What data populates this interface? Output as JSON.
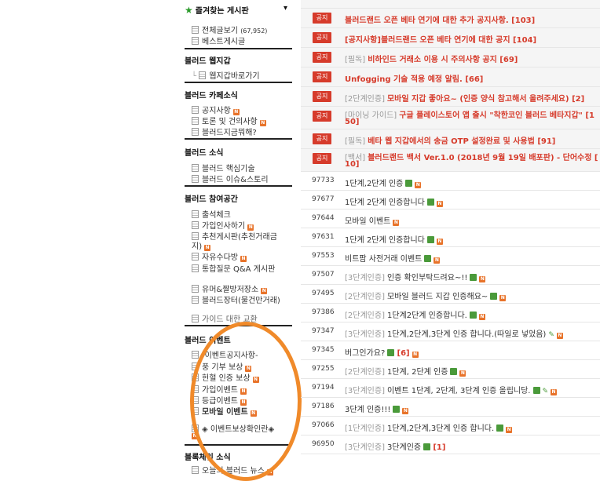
{
  "sidebar": {
    "favorites": {
      "title": "즐겨찾는 게시판",
      "toggle": "▾",
      "items": [
        {
          "label": "전체글보기",
          "count": "(67,952)"
        },
        {
          "label": "베스트게시글"
        }
      ]
    },
    "wallet": {
      "title": "블러드 웹지갑",
      "items": [
        {
          "label": "웹지갑바로가기"
        }
      ]
    },
    "cafe": {
      "title": "블러드 카페소식",
      "items": [
        {
          "label": "공지사항"
        },
        {
          "label": "토론 및 건의사항"
        },
        {
          "label": "블러드지금뭐해?"
        }
      ]
    },
    "news": {
      "title": "블러드 소식",
      "items": [
        {
          "label": "블러드 핵심기술"
        },
        {
          "label": "블러드 이슈&스토리"
        }
      ]
    },
    "participate": {
      "title": "블러드 참여공간",
      "items": [
        {
          "label": "출석체크"
        },
        {
          "label": "가입인사하기"
        },
        {
          "label": "추천게시판(추천거래금"
        },
        {
          "label": "지)"
        },
        {
          "label": "자유수다방"
        },
        {
          "label": "통합질문 Q&A 게시판"
        },
        {
          "label": "유머&짤방저장소"
        },
        {
          "label": "블러드장터(물건만거래)"
        },
        {
          "label": "가이드 대한 교환"
        }
      ]
    },
    "event": {
      "title": "블러드 이벤트",
      "items": [
        {
          "label": "-이벤트공지사항-"
        },
        {
          "label": "풍 기부 보상"
        },
        {
          "label": "헌혈 인증 보상"
        },
        {
          "label": "가입이벤트"
        },
        {
          "label": "등급이벤트"
        },
        {
          "label": "모바일 이벤트"
        },
        {
          "label": "◈ 이벤트보상확인란◈"
        }
      ]
    },
    "last": {
      "title": "블록체인 소식",
      "items": [
        {
          "label": "오늘의 블러드 뉴스"
        }
      ]
    }
  },
  "notices": [
    {
      "tag": "공지",
      "cat": "",
      "title": "블러드랜드 오픈 베타 연기에 대한 추가 공지사항.",
      "cnt": "[103]"
    },
    {
      "tag": "공지",
      "cat": "",
      "title": "[공지사항]블러드랜드 오픈 베타 연기에 대한 공지",
      "cnt": "[104]"
    },
    {
      "tag": "공지",
      "cat": "[필독]",
      "title": "비하인드 거래소 이용 시 주의사항 공지",
      "cnt": "[69]"
    },
    {
      "tag": "공지",
      "cat": "",
      "title": "Unfogging 기술 적용 예정 알림.",
      "cnt": "[66]"
    },
    {
      "tag": "공지",
      "cat": "[2단계인증]",
      "title": "모바일 지갑 좋아요~ (인증 양식 참고해서 올려주세요)",
      "cnt": "[2]"
    },
    {
      "tag": "공지",
      "cat": "[마이닝 가이드]",
      "title": "구글 플레이스토어 앱 출시 \"착한코인 블러드 베타지갑\" [1",
      "cnt": "50]"
    },
    {
      "tag": "공지",
      "cat": "[필독]",
      "title": "베타 웹 지갑에서의 송금 OTP 설정완료 및 사용법",
      "cnt": "[91]"
    },
    {
      "tag": "공지",
      "cat": "[백서]",
      "title": "블러드랜드 백서 Ver.1.0 (2018년 9월 19일 배포판) - 단어수정 [",
      "cnt": "10]"
    }
  ],
  "posts": [
    {
      "num": "97733",
      "cat": "",
      "title": "1단계,2단계 인증",
      "cnt": ""
    },
    {
      "num": "97677",
      "cat": "",
      "title": "1단계 2단계 인증합니다",
      "cnt": ""
    },
    {
      "num": "97644",
      "cat": "",
      "title": "모바일 이벤트",
      "cnt": ""
    },
    {
      "num": "97631",
      "cat": "",
      "title": "1단계 2단계 인증합니다",
      "cnt": ""
    },
    {
      "num": "97553",
      "cat": "",
      "title": "비트팜 사전거래 이벤트",
      "cnt": ""
    },
    {
      "num": "97507",
      "cat": "[3단계인증]",
      "title": "인증 확인부탁드려요~!!",
      "cnt": ""
    },
    {
      "num": "97495",
      "cat": "[2단계인증]",
      "title": "모바일 블러드 지갑 인증해요~",
      "cnt": ""
    },
    {
      "num": "97386",
      "cat": "[2단계인증]",
      "title": "1단계2단계 인증합니다.",
      "cnt": ""
    },
    {
      "num": "97347",
      "cat": "[3단계인증]",
      "title": "1단계,2단계,3단계 인증 합니다.(따일로 넣었음)",
      "cnt": ""
    },
    {
      "num": "97345",
      "cat": "",
      "title": "버그인가요?",
      "cnt": "[6]"
    },
    {
      "num": "97255",
      "cat": "[2단계인증]",
      "title": "1단계, 2단계 인증",
      "cnt": ""
    },
    {
      "num": "97194",
      "cat": "[3단계인증]",
      "title": "이벤트 1단계, 2단계, 3단계 인증 올립니당.",
      "cnt": ""
    },
    {
      "num": "97186",
      "cat": "",
      "title": "3단계 인증!!!",
      "cnt": ""
    },
    {
      "num": "97066",
      "cat": "[1단계인증]",
      "title": "1단계,2단계,3단계 인증 합니다.",
      "cnt": ""
    },
    {
      "num": "96950",
      "cat": "[3단계인증]",
      "title": "3단계인증",
      "cnt": "[1]"
    }
  ]
}
